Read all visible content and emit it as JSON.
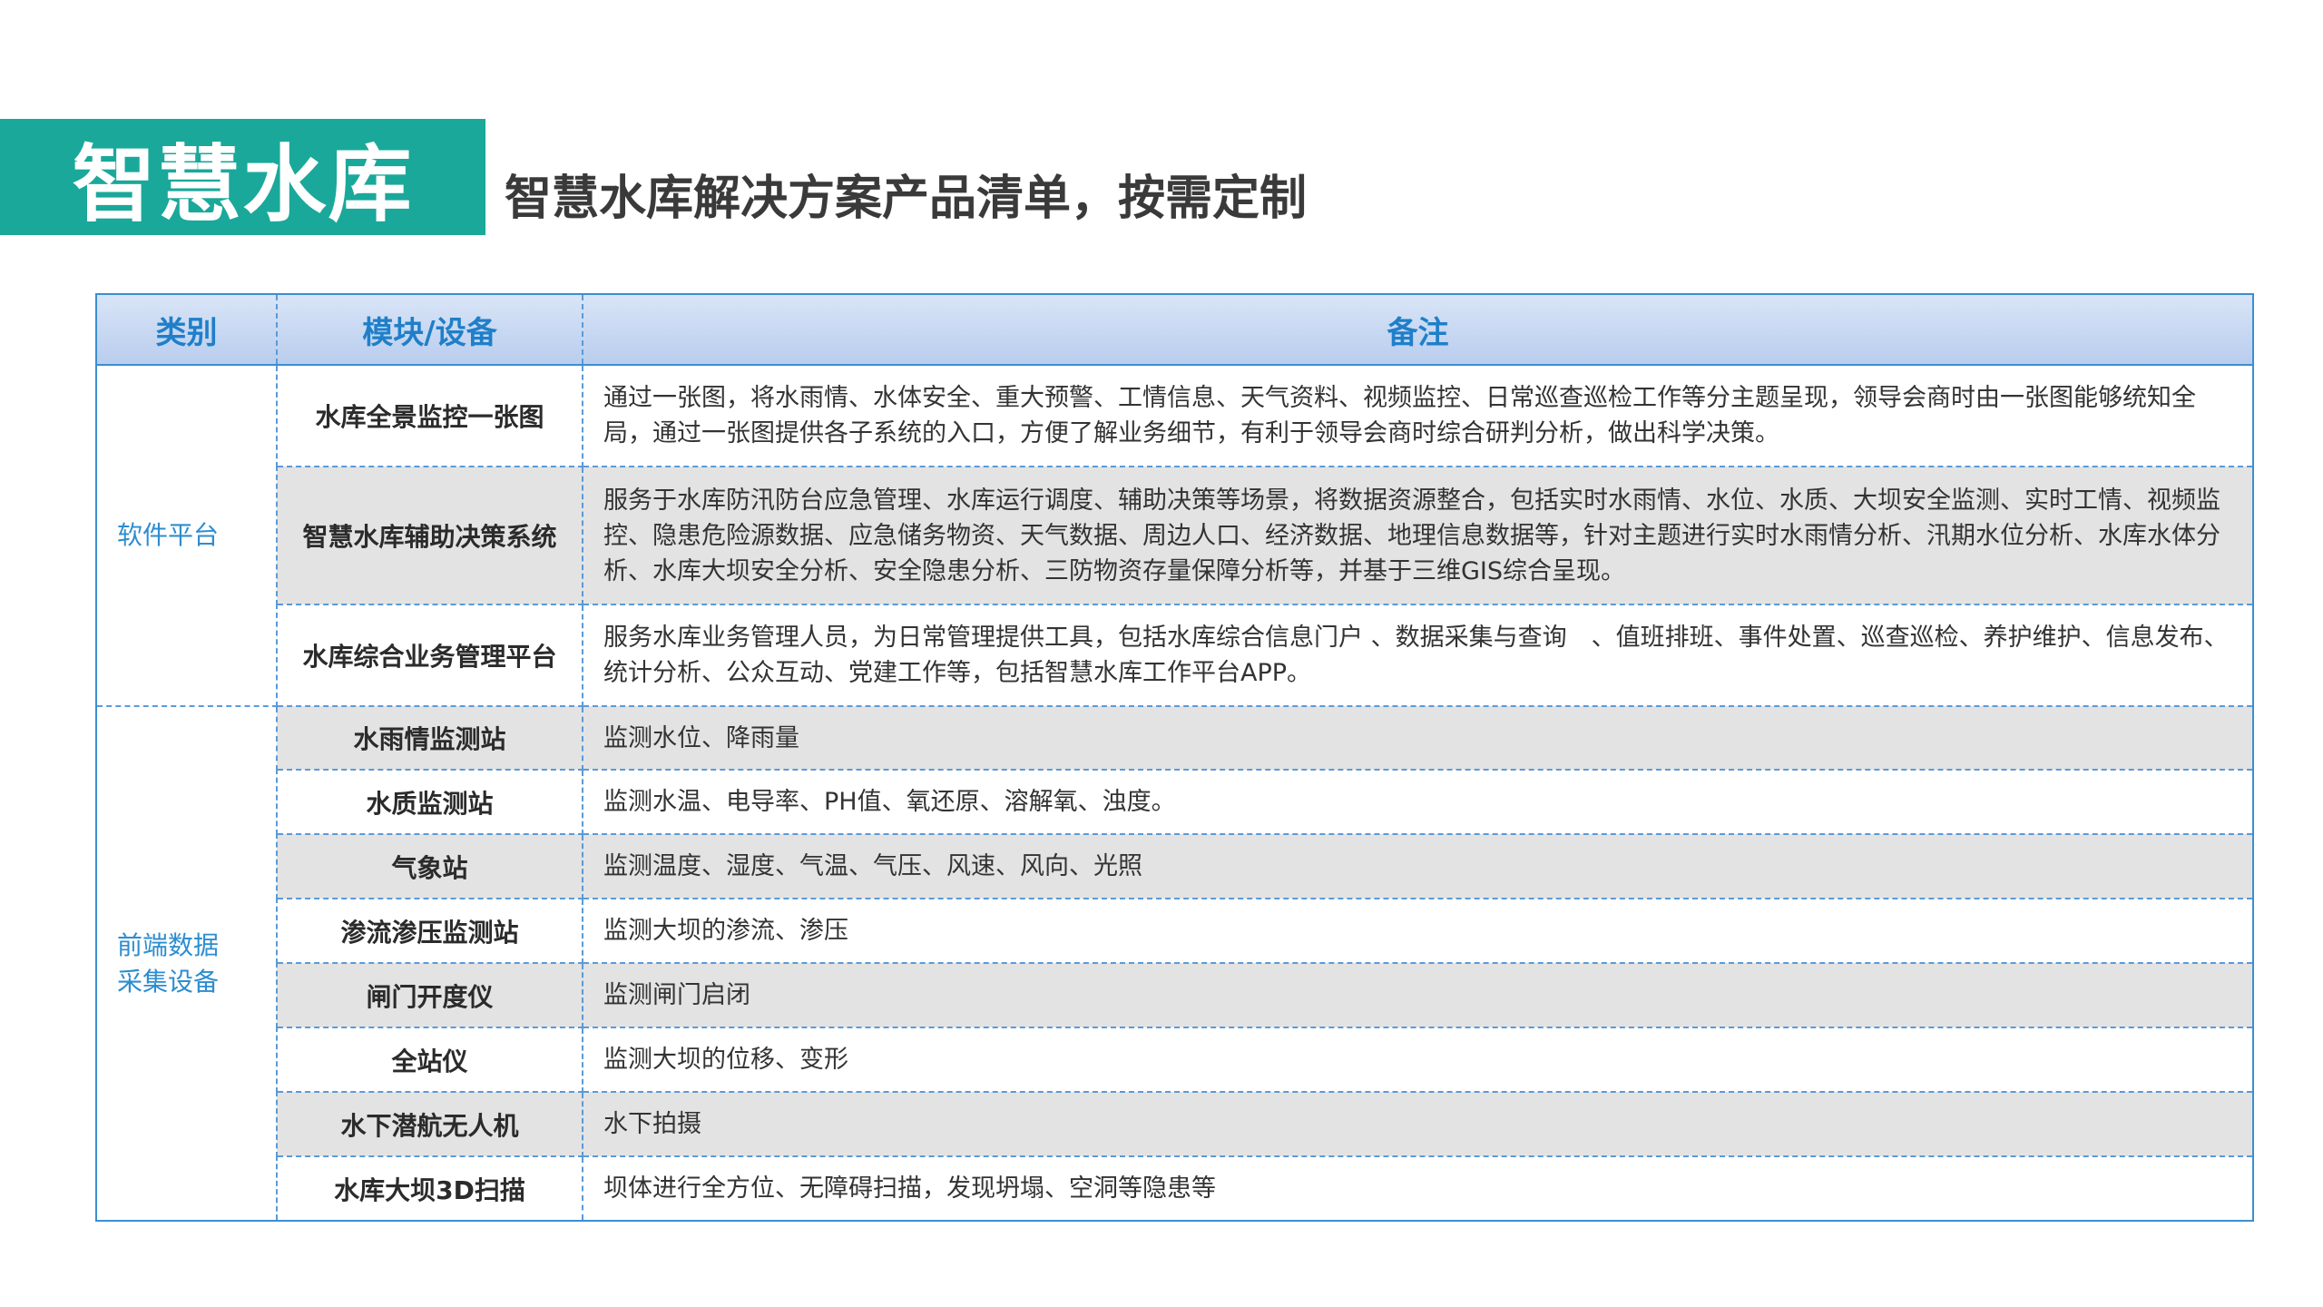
{
  "header": {
    "badge": "智慧水库",
    "subtitle": "智慧水库解决方案产品清单，按需定制"
  },
  "table": {
    "columns": [
      "类别",
      "模块/设备",
      "备注"
    ],
    "groups": [
      {
        "category": "软件平台",
        "rows": [
          {
            "module": "水库全景监控一张图",
            "note": "通过一张图，将水雨情、水体安全、重大预警、工情信息、天气资料、视频监控、日常巡查巡检工作等分主题呈现，领导会商时由一张图能够统知全局，通过一张图提供各子系统的入口，方便了解业务细节，有利于领导会商时综合研判分析，做出科学决策。"
          },
          {
            "module": "智慧水库辅助决策系统",
            "note": "服务于水库防汛防台应急管理、水库运行调度、辅助决策等场景，将数据资源整合，包括实时水雨情、水位、水质、大坝安全监测、实时工情、视频监控、隐患危险源数据、应急储务物资、天气数据、周边人口、经济数据、地理信息数据等，针对主题进行实时水雨情分析、汛期水位分析、水库水体分析、水库大坝安全分析、安全隐患分析、三防物资存量保障分析等，并基于三维GIS综合呈现。"
          },
          {
            "module": "水库综合业务管理平台",
            "note": "服务水库业务管理人员，为日常管理提供工具，包括水库综合信息门户 、数据采集与查询　、值班排班、事件处置、巡查巡检、养护维护、信息发布、统计分析、公众互动、党建工作等，包括智慧水库工作平台APP。"
          }
        ]
      },
      {
        "category_line1": "前端数据",
        "category_line2": "采集设备",
        "rows": [
          {
            "module": "水雨情监测站",
            "note": "监测水位、降雨量"
          },
          {
            "module": "水质监测站",
            "note": "监测水温、电导率、PH值、氧还原、溶解氧、浊度。"
          },
          {
            "module": "气象站",
            "note": "监测温度、湿度、气温、气压、风速、风向、光照"
          },
          {
            "module": "渗流渗压监测站",
            "note": "监测大坝的渗流、渗压"
          },
          {
            "module": "闸门开度仪",
            "note": "监测闸门启闭"
          },
          {
            "module": "全站仪",
            "note": "监测大坝的位移、变形"
          },
          {
            "module": "水下潜航无人机",
            "note": "水下拍摄"
          },
          {
            "module": "水库大坝3D扫描",
            "note": "坝体进行全方位、无障碍扫描，发现坍塌、空洞等隐患等"
          }
        ]
      }
    ]
  },
  "colors": {
    "accent": "#1aa89a",
    "header_text": "#1f7fc9",
    "category_text": "#2d8dd0",
    "border": "#5b9ad8",
    "row_shade": "#e3e3e3"
  }
}
